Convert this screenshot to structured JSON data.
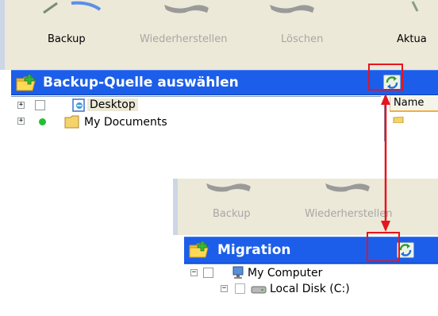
{
  "top_panel": {
    "toolbar": {
      "backup_label": "Backup",
      "restore_label": "Wiederherstellen",
      "delete_label": "Löschen",
      "refresh_label": "Aktua"
    },
    "section_title": "Backup-Quelle auswählen",
    "tree": [
      {
        "label": "Desktop"
      },
      {
        "label": "My Documents"
      }
    ],
    "list_header": "Name"
  },
  "bottom_panel": {
    "toolbar": {
      "backup_label": "Backup",
      "restore_label": "Wiederherstellen"
    },
    "section_title": "Migration",
    "tree": [
      {
        "label": "My Computer"
      },
      {
        "label": "Local Disk (C:)"
      }
    ]
  },
  "colors": {
    "section_bar": "#1c5ee9",
    "highlight": "#e6141e",
    "toolbar_bg": "#ece9d8"
  }
}
